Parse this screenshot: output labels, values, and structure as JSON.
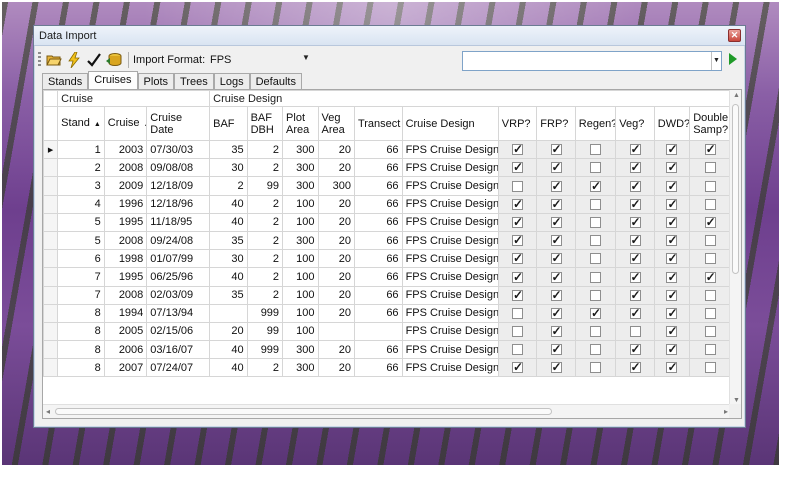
{
  "window": {
    "title": "Data Import"
  },
  "toolbar": {
    "format_label": "Import Format:",
    "format_value": "FPS",
    "search_value": ""
  },
  "tabs": [
    "Stands",
    "Cruises",
    "Plots",
    "Trees",
    "Logs",
    "Defaults"
  ],
  "active_tab": "Cruises",
  "grid": {
    "bands": {
      "cruise": "Cruise",
      "design": "Cruise Design"
    },
    "columns": [
      "Stand",
      "Cruise",
      "Cruise Date",
      "BAF",
      "BAF DBH",
      "Plot Area",
      "Veg Area",
      "Transect",
      "Cruise Design",
      "VRP?",
      "FRP?",
      "Regen?",
      "Veg?",
      "DWD?",
      "Double Samp?"
    ],
    "rows": [
      {
        "stand": "1",
        "cruise": "2003",
        "date": "07/30/03",
        "baf": "35",
        "baf_dbh": "2",
        "plot": "300",
        "veg": "20",
        "transect": "66",
        "design": "FPS Cruise Design",
        "vrp": true,
        "frp": true,
        "regen": false,
        "vegq": true,
        "dwd": true,
        "dbl": true
      },
      {
        "stand": "2",
        "cruise": "2008",
        "date": "09/08/08",
        "baf": "30",
        "baf_dbh": "2",
        "plot": "300",
        "veg": "20",
        "transect": "66",
        "design": "FPS Cruise Design",
        "vrp": true,
        "frp": true,
        "regen": false,
        "vegq": true,
        "dwd": true,
        "dbl": false
      },
      {
        "stand": "3",
        "cruise": "2009",
        "date": "12/18/09",
        "baf": "2",
        "baf_dbh": "99",
        "plot": "300",
        "veg": "300",
        "transect": "66",
        "design": "FPS Cruise Design",
        "vrp": false,
        "frp": true,
        "regen": true,
        "vegq": true,
        "dwd": true,
        "dbl": false
      },
      {
        "stand": "4",
        "cruise": "1996",
        "date": "12/18/96",
        "baf": "40",
        "baf_dbh": "2",
        "plot": "100",
        "veg": "20",
        "transect": "66",
        "design": "FPS Cruise Design",
        "vrp": true,
        "frp": true,
        "regen": false,
        "vegq": true,
        "dwd": true,
        "dbl": false
      },
      {
        "stand": "5",
        "cruise": "1995",
        "date": "11/18/95",
        "baf": "40",
        "baf_dbh": "2",
        "plot": "100",
        "veg": "20",
        "transect": "66",
        "design": "FPS Cruise Design",
        "vrp": true,
        "frp": true,
        "regen": false,
        "vegq": true,
        "dwd": true,
        "dbl": true
      },
      {
        "stand": "5",
        "cruise": "2008",
        "date": "09/24/08",
        "baf": "35",
        "baf_dbh": "2",
        "plot": "300",
        "veg": "20",
        "transect": "66",
        "design": "FPS Cruise Design",
        "vrp": true,
        "frp": true,
        "regen": false,
        "vegq": true,
        "dwd": true,
        "dbl": false
      },
      {
        "stand": "6",
        "cruise": "1998",
        "date": "01/07/99",
        "baf": "30",
        "baf_dbh": "2",
        "plot": "100",
        "veg": "20",
        "transect": "66",
        "design": "FPS Cruise Design",
        "vrp": true,
        "frp": true,
        "regen": false,
        "vegq": true,
        "dwd": true,
        "dbl": false
      },
      {
        "stand": "7",
        "cruise": "1995",
        "date": "06/25/96",
        "baf": "40",
        "baf_dbh": "2",
        "plot": "100",
        "veg": "20",
        "transect": "66",
        "design": "FPS Cruise Design",
        "vrp": true,
        "frp": true,
        "regen": false,
        "vegq": true,
        "dwd": true,
        "dbl": true
      },
      {
        "stand": "7",
        "cruise": "2008",
        "date": "02/03/09",
        "baf": "35",
        "baf_dbh": "2",
        "plot": "100",
        "veg": "20",
        "transect": "66",
        "design": "FPS Cruise Design",
        "vrp": true,
        "frp": true,
        "regen": false,
        "vegq": true,
        "dwd": true,
        "dbl": false
      },
      {
        "stand": "8",
        "cruise": "1994",
        "date": "07/13/94",
        "baf": "",
        "baf_dbh": "999",
        "plot": "100",
        "veg": "20",
        "transect": "66",
        "design": "FPS Cruise Design",
        "vrp": false,
        "frp": true,
        "regen": true,
        "vegq": true,
        "dwd": true,
        "dbl": false
      },
      {
        "stand": "8",
        "cruise": "2005",
        "date": "02/15/06",
        "baf": "20",
        "baf_dbh": "99",
        "plot": "100",
        "veg": "",
        "transect": "",
        "design": "FPS Cruise Design",
        "vrp": false,
        "frp": true,
        "regen": false,
        "vegq": false,
        "dwd": true,
        "dbl": false
      },
      {
        "stand": "8",
        "cruise": "2006",
        "date": "03/16/07",
        "baf": "40",
        "baf_dbh": "999",
        "plot": "300",
        "veg": "20",
        "transect": "66",
        "design": "FPS Cruise Design",
        "vrp": false,
        "frp": true,
        "regen": false,
        "vegq": true,
        "dwd": true,
        "dbl": false
      },
      {
        "stand": "8",
        "cruise": "2007",
        "date": "07/24/07",
        "baf": "40",
        "baf_dbh": "2",
        "plot": "300",
        "veg": "20",
        "transect": "66",
        "design": "FPS Cruise Design",
        "vrp": true,
        "frp": true,
        "regen": false,
        "vegq": true,
        "dwd": true,
        "dbl": false
      }
    ]
  }
}
